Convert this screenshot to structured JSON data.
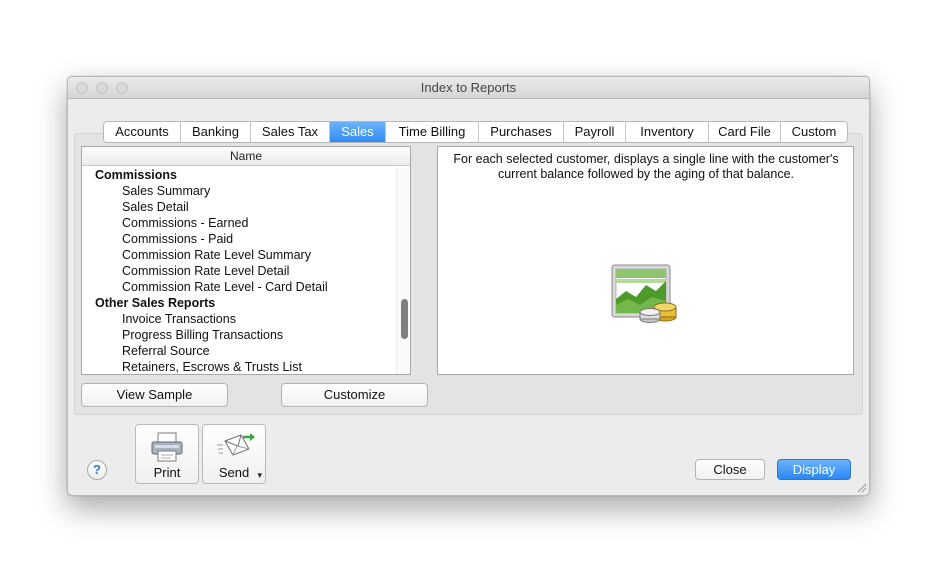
{
  "window": {
    "title": "Index to Reports"
  },
  "tabs": [
    {
      "label": "Accounts",
      "active": false
    },
    {
      "label": "Banking",
      "active": false
    },
    {
      "label": "Sales Tax",
      "active": false
    },
    {
      "label": "Sales",
      "active": true
    },
    {
      "label": "Time Billing",
      "active": false
    },
    {
      "label": "Purchases",
      "active": false
    },
    {
      "label": "Payroll",
      "active": false
    },
    {
      "label": "Inventory",
      "active": false
    },
    {
      "label": "Card File",
      "active": false
    },
    {
      "label": "Custom",
      "active": false
    }
  ],
  "report_list": {
    "header": "Name",
    "items": [
      {
        "label": "Commissions",
        "group": true
      },
      {
        "label": "Sales Summary",
        "group": false
      },
      {
        "label": "Sales Detail",
        "group": false
      },
      {
        "label": "Commissions - Earned",
        "group": false
      },
      {
        "label": "Commissions - Paid",
        "group": false
      },
      {
        "label": "Commission Rate Level Summary",
        "group": false
      },
      {
        "label": "Commission Rate Level Detail",
        "group": false
      },
      {
        "label": "Commission Rate Level - Card Detail",
        "group": false
      },
      {
        "label": "Other Sales Reports",
        "group": true
      },
      {
        "label": "Invoice Transactions",
        "group": false
      },
      {
        "label": "Progress Billing Transactions",
        "group": false
      },
      {
        "label": "Referral Source",
        "group": false
      },
      {
        "label": "Retainers, Escrows & Trusts List",
        "group": false
      }
    ]
  },
  "description": "For each selected customer, displays a single line with the customer's current balance followed by the aging of that balance.",
  "buttons": {
    "view_sample": "View Sample",
    "customize": "Customize",
    "close": "Close",
    "display": "Display",
    "help": "?"
  },
  "toolbar": {
    "print_label": "Print",
    "send_label": "Send",
    "send_caret": "▾"
  },
  "colors": {
    "accent": "#2f8cf5",
    "window_bg": "#ececec"
  }
}
